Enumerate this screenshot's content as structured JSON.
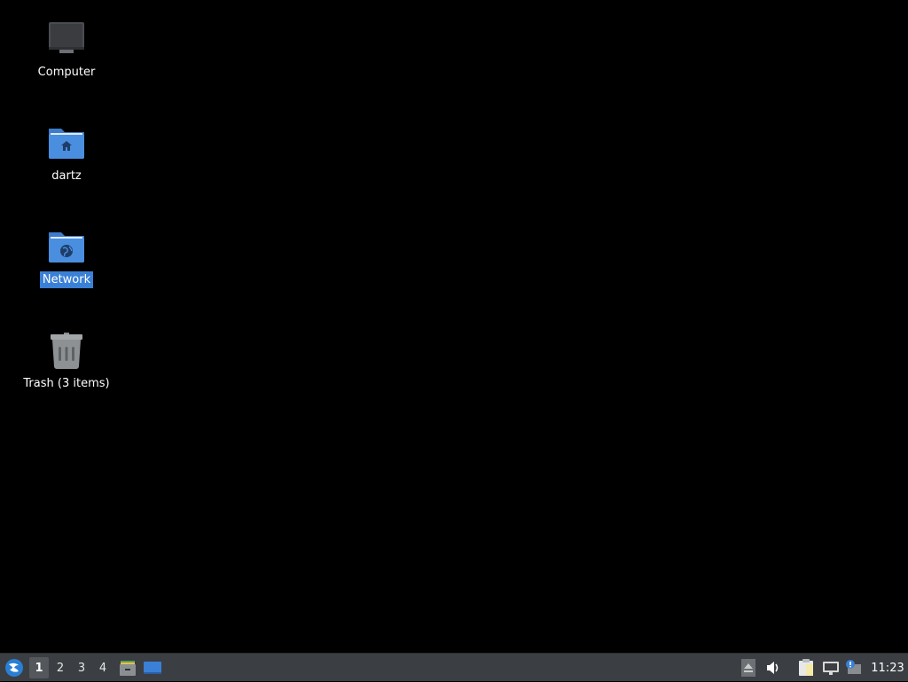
{
  "desktop": {
    "icons": [
      {
        "label": "Computer",
        "icon": "computer-icon",
        "selected": false
      },
      {
        "label": "dartz",
        "icon": "home-folder-icon",
        "selected": false
      },
      {
        "label": "Network",
        "icon": "network-folder-icon",
        "selected": true
      },
      {
        "label": "Trash (3 items)",
        "icon": "trash-icon",
        "selected": false
      }
    ]
  },
  "panel": {
    "menu_icon": "lxqt-start-menu-icon",
    "workspaces": [
      "1",
      "2",
      "3",
      "4"
    ],
    "active_workspace": "1",
    "quicklaunch": [
      "file-manager-icon",
      "show-desktop-icon"
    ],
    "tray": [
      "eject-icon",
      "volume-icon",
      "clipboard-icon",
      "network-icon",
      "update-notifier-icon"
    ],
    "clock": "11:23"
  },
  "colors": {
    "desktop_bg": "#000000",
    "panel_bg": "#3b3e42",
    "selection": "#3a80d6",
    "folder_blue": "#4a8ee0"
  }
}
